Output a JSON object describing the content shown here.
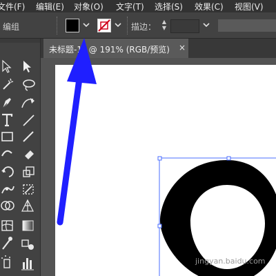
{
  "menu": {
    "items": [
      {
        "label": "文件(F)"
      },
      {
        "label": "编辑(E)"
      },
      {
        "label": "对象(O)"
      },
      {
        "label": "文字(T)"
      },
      {
        "label": "选择(S)"
      },
      {
        "label": "效果(C)"
      },
      {
        "label": "视图(V)"
      }
    ]
  },
  "control_bar": {
    "selection_label": "编组",
    "fill_color": "#000000",
    "stroke_color": "none",
    "stroke_label": "描边：",
    "stroke_weight": ""
  },
  "document": {
    "tab_title": "未标题-1* @ 191% (RGB/预览)",
    "close_symbol": "×"
  },
  "artwork": {
    "shape": "letter-o-glyph",
    "color": "#000000"
  },
  "annotation": {
    "arrow_color": "#1a1aff"
  },
  "watermark": {
    "text": "jingyan.baidu.com"
  },
  "tools": [
    "selection-tool-icon",
    "direct-selection-tool-icon",
    "magic-wand-tool-icon",
    "lasso-tool-icon",
    "pen-tool-icon",
    "curvature-tool-icon",
    "type-tool-icon",
    "line-segment-tool-icon",
    "rectangle-tool-icon",
    "paintbrush-tool-icon",
    "shaper-tool-icon",
    "eraser-tool-icon",
    "rotate-tool-icon",
    "scale-tool-icon",
    "width-tool-icon",
    "free-transform-tool-icon",
    "shape-builder-tool-icon",
    "perspective-grid-tool-icon",
    "mesh-tool-icon",
    "gradient-tool-icon",
    "eyedropper-tool-icon",
    "blend-tool-icon",
    "symbol-sprayer-tool-icon",
    "column-graph-tool-icon"
  ]
}
